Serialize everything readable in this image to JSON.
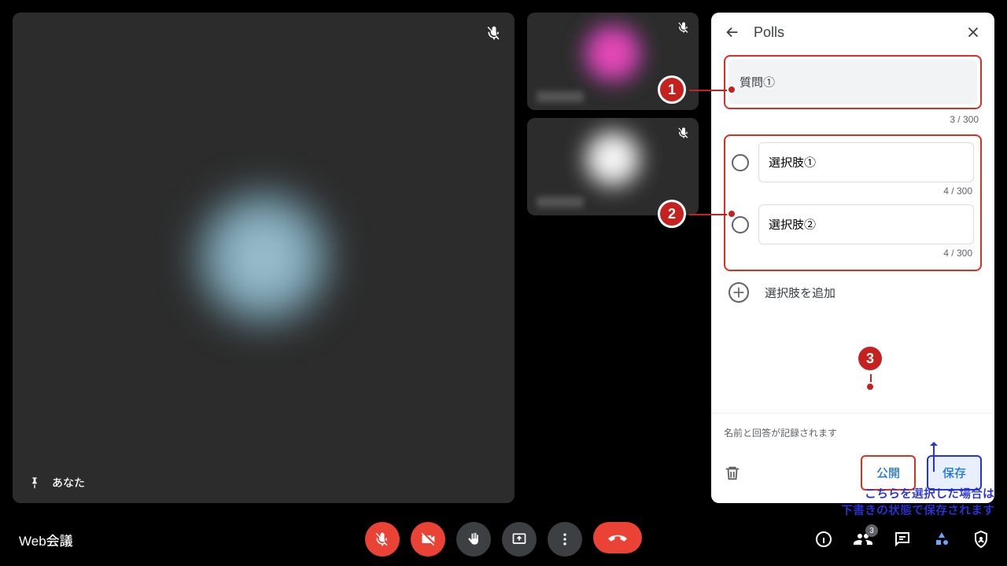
{
  "main": {
    "self_label": "あなた"
  },
  "panel": {
    "title": "Polls",
    "question_value": "質問①",
    "question_counter": "3 / 300",
    "options": [
      {
        "value": "選択肢①",
        "counter": "4 / 300"
      },
      {
        "value": "選択肢②",
        "counter": "4 / 300"
      }
    ],
    "add_option_label": "選択肢を追加",
    "footer_note": "名前と回答が記録されます",
    "publish_label": "公開",
    "save_label": "保存"
  },
  "bottom": {
    "meeting_name": "Web会議",
    "people_count": "3"
  },
  "annotations": {
    "c1": "1",
    "c2": "2",
    "c3": "3",
    "blue_line1": "こちらを選択した場合は",
    "blue_line2": "下書きの状態で保存されます"
  }
}
